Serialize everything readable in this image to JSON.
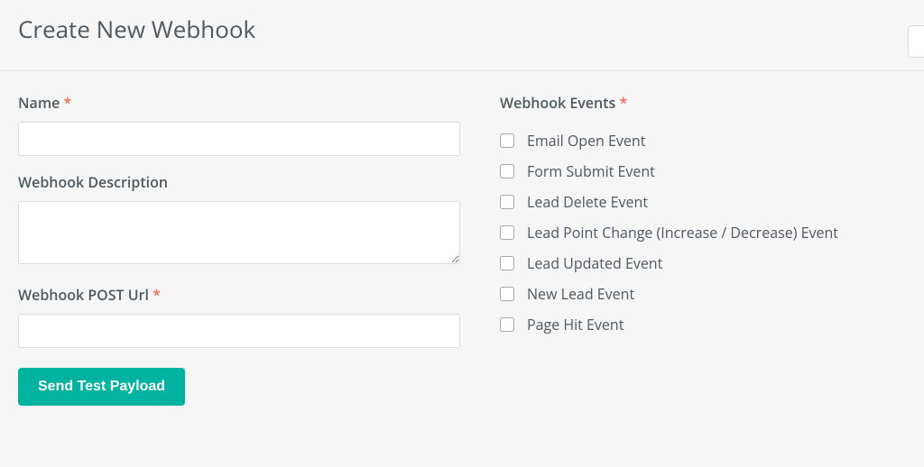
{
  "header": {
    "title": "Create New Webhook"
  },
  "form": {
    "name": {
      "label": "Name",
      "required": true,
      "value": ""
    },
    "description": {
      "label": "Webhook Description",
      "required": false,
      "value": ""
    },
    "post_url": {
      "label": "Webhook POST Url",
      "required": true,
      "value": ""
    },
    "send_test_button": "Send Test Payload"
  },
  "events": {
    "label": "Webhook Events",
    "required": true,
    "items": [
      {
        "label": "Email Open Event",
        "checked": false
      },
      {
        "label": "Form Submit Event",
        "checked": false
      },
      {
        "label": "Lead Delete Event",
        "checked": false
      },
      {
        "label": "Lead Point Change (Increase / Decrease) Event",
        "checked": false
      },
      {
        "label": "Lead Updated Event",
        "checked": false
      },
      {
        "label": "New Lead Event",
        "checked": false
      },
      {
        "label": "Page Hit Event",
        "checked": false
      }
    ]
  },
  "colors": {
    "accent": "#00b3a1",
    "required": "#f56954"
  }
}
